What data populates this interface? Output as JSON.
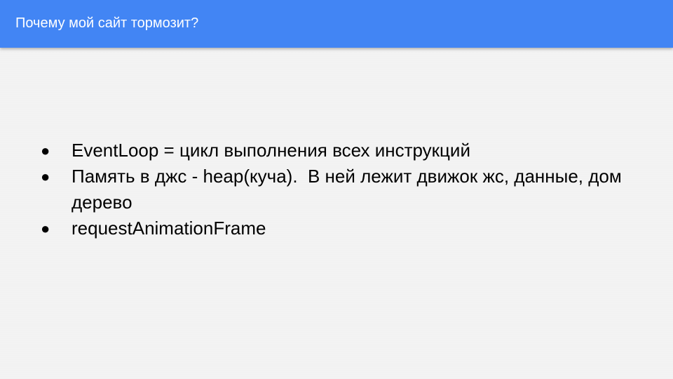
{
  "slide": {
    "title": "Почему мой сайт тормозит?",
    "bullet_symbol": "●",
    "bullets": [
      "EventLoop = цикл выполнения всех инструкций",
      "Память в джс - heap(куча).  В ней лежит движок жс, данные, дом дерево",
      "requestAnimationFrame"
    ]
  },
  "colors": {
    "header": "#4285f4",
    "background": "#f3f3f3",
    "title_text": "#ffffff",
    "body_text": "#000000"
  }
}
